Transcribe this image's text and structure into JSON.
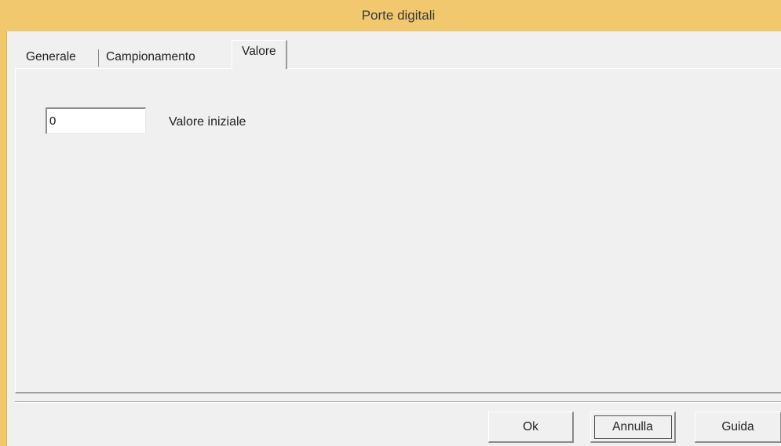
{
  "window": {
    "title": "Porte digitali"
  },
  "tabs": [
    {
      "label": "Generale",
      "active": false
    },
    {
      "label": "Campionamento",
      "active": false
    },
    {
      "label": "Valore",
      "active": true
    }
  ],
  "panel": {
    "initial_value": {
      "value": "0",
      "label": "Valore iniziale"
    }
  },
  "buttons": {
    "ok": "Ok",
    "cancel": "Annulla",
    "help": "Guida"
  },
  "colors": {
    "title_bar": "#f1c86d",
    "dialog_bg": "#f0f0f0"
  }
}
